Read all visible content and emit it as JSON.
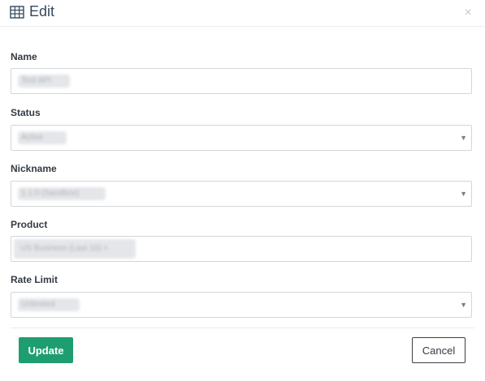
{
  "header": {
    "title": "Edit",
    "icon": "table-icon",
    "close_glyph": "×"
  },
  "fields": {
    "name": {
      "label": "Name",
      "value": "Test API"
    },
    "status": {
      "label": "Status",
      "value": "Active"
    },
    "nickname": {
      "label": "Nickname",
      "value": "1.1.0 (Sandbox)"
    },
    "product": {
      "label": "Product",
      "value": "US Business (Last 10) ×"
    },
    "rate_limit": {
      "label": "Rate Limit",
      "value": "Unlimited"
    }
  },
  "footer": {
    "update_label": "Update",
    "cancel_label": "Cancel"
  },
  "colors": {
    "primary": "#1e9e70",
    "title": "#34495e",
    "label": "#333a44",
    "border": "#d3d6da"
  }
}
